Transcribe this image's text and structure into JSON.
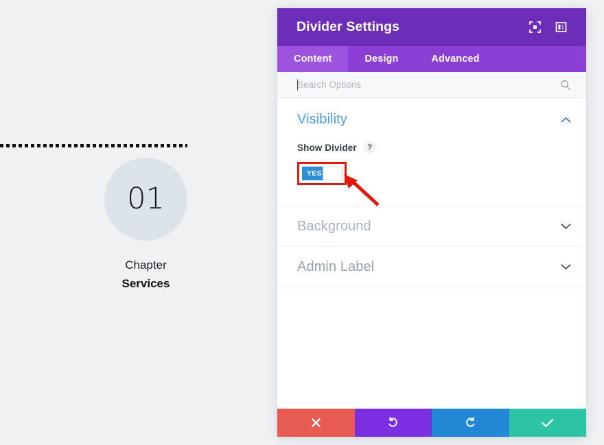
{
  "preview": {
    "divider": {
      "style": "dotted",
      "color": "#121212"
    },
    "chapter": {
      "number": "01",
      "label": "Chapter",
      "title": "Services",
      "circle_color": "#dde3ea"
    }
  },
  "modal": {
    "title": "Divider Settings",
    "header_icons": [
      {
        "name": "expand-view-icon",
        "label": "Expand View"
      },
      {
        "name": "layout-view-icon",
        "label": "Change Layout"
      }
    ],
    "tabs": [
      {
        "label": "Content",
        "active": true
      },
      {
        "label": "Design",
        "active": false
      },
      {
        "label": "Advanced",
        "active": false
      }
    ],
    "search": {
      "value": "",
      "placeholder": "Search Options",
      "icon": "search-icon"
    },
    "sections": [
      {
        "name": "visibility",
        "title": "Visibility",
        "expanded": true,
        "chevron": "chevron-up-icon",
        "fields": [
          {
            "label": "Show Divider",
            "help": "?",
            "control": "toggle",
            "value": "YES",
            "state": "on",
            "highlighted": true
          }
        ]
      },
      {
        "name": "background",
        "title": "Background",
        "expanded": false,
        "chevron": "chevron-down-icon"
      },
      {
        "name": "admin-label",
        "title": "Admin Label",
        "expanded": false,
        "chevron": "chevron-down-icon"
      }
    ],
    "footer": [
      {
        "name": "cancel",
        "icon": "close-icon",
        "color": "#e75b52"
      },
      {
        "name": "undo",
        "icon": "undo-icon",
        "color": "#7b2fe0"
      },
      {
        "name": "redo",
        "icon": "redo-icon",
        "color": "#2288d6"
      },
      {
        "name": "save",
        "icon": "check-icon",
        "color": "#2cc4a5"
      }
    ]
  },
  "annotation": {
    "type": "arrow",
    "color": "#e01b0e",
    "points_to": "show-divider-toggle"
  },
  "colors": {
    "header_purple": "#6c2eb9",
    "tabs_purple": "#8b3fd4",
    "tab_active_purple": "#9d53e0",
    "section_title_blue": "#4a9ae3",
    "toggle_blue": "#2e8fd8",
    "annotation_red": "#e01b0e",
    "page_background": "#f0f1f3"
  }
}
